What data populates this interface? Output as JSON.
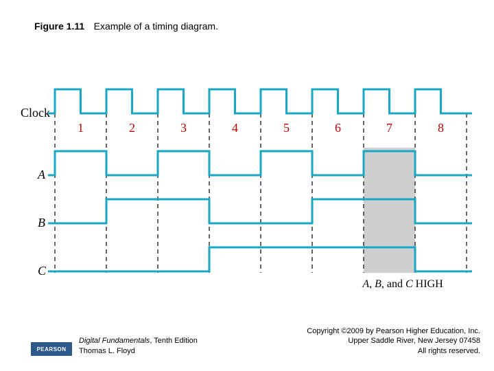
{
  "caption": {
    "figure_label": "Figure 1.11",
    "text": "Example of a timing diagram."
  },
  "labels": {
    "clock": "Clock",
    "a": "A",
    "b": "B",
    "c": "C"
  },
  "periods": {
    "n1": "1",
    "n2": "2",
    "n3": "3",
    "n4": "4",
    "n5": "5",
    "n6": "6",
    "n7": "7",
    "n8": "8"
  },
  "annotation": {
    "a": "A",
    "bc": "B",
    "and": ", and ",
    "c": "C",
    "high": " HIGH",
    "abc_prefix": ", "
  },
  "footer": {
    "logo": "PEARSON",
    "book_title": "Digital Fundamentals",
    "book_edition": ", Tenth Edition",
    "author": "Thomas L. Floyd",
    "copyright1": "Copyright ©2009 by Pearson Higher Education, Inc.",
    "copyright2": "Upper Saddle River, New Jersey 07458",
    "copyright3": "All rights reserved."
  },
  "chart_data": {
    "type": "timing-diagram",
    "clock_periods": 8,
    "period_labels": [
      "1",
      "2",
      "3",
      "4",
      "5",
      "6",
      "7",
      "8"
    ],
    "signals": [
      {
        "name": "Clock",
        "pattern": [
          0,
          1,
          0,
          1,
          0,
          1,
          0,
          1,
          0,
          1,
          0,
          1,
          0,
          1,
          0,
          1,
          0
        ]
      },
      {
        "name": "A",
        "values_per_period": [
          1,
          0,
          1,
          0,
          1,
          0,
          1,
          0
        ]
      },
      {
        "name": "B",
        "values_per_period": [
          0,
          1,
          1,
          0,
          0,
          1,
          1,
          0
        ]
      },
      {
        "name": "C",
        "values_per_period": [
          0,
          0,
          0,
          1,
          1,
          1,
          1,
          0
        ]
      }
    ],
    "highlight": {
      "periods": [
        7
      ],
      "meaning": "A, B, and C HIGH"
    }
  }
}
